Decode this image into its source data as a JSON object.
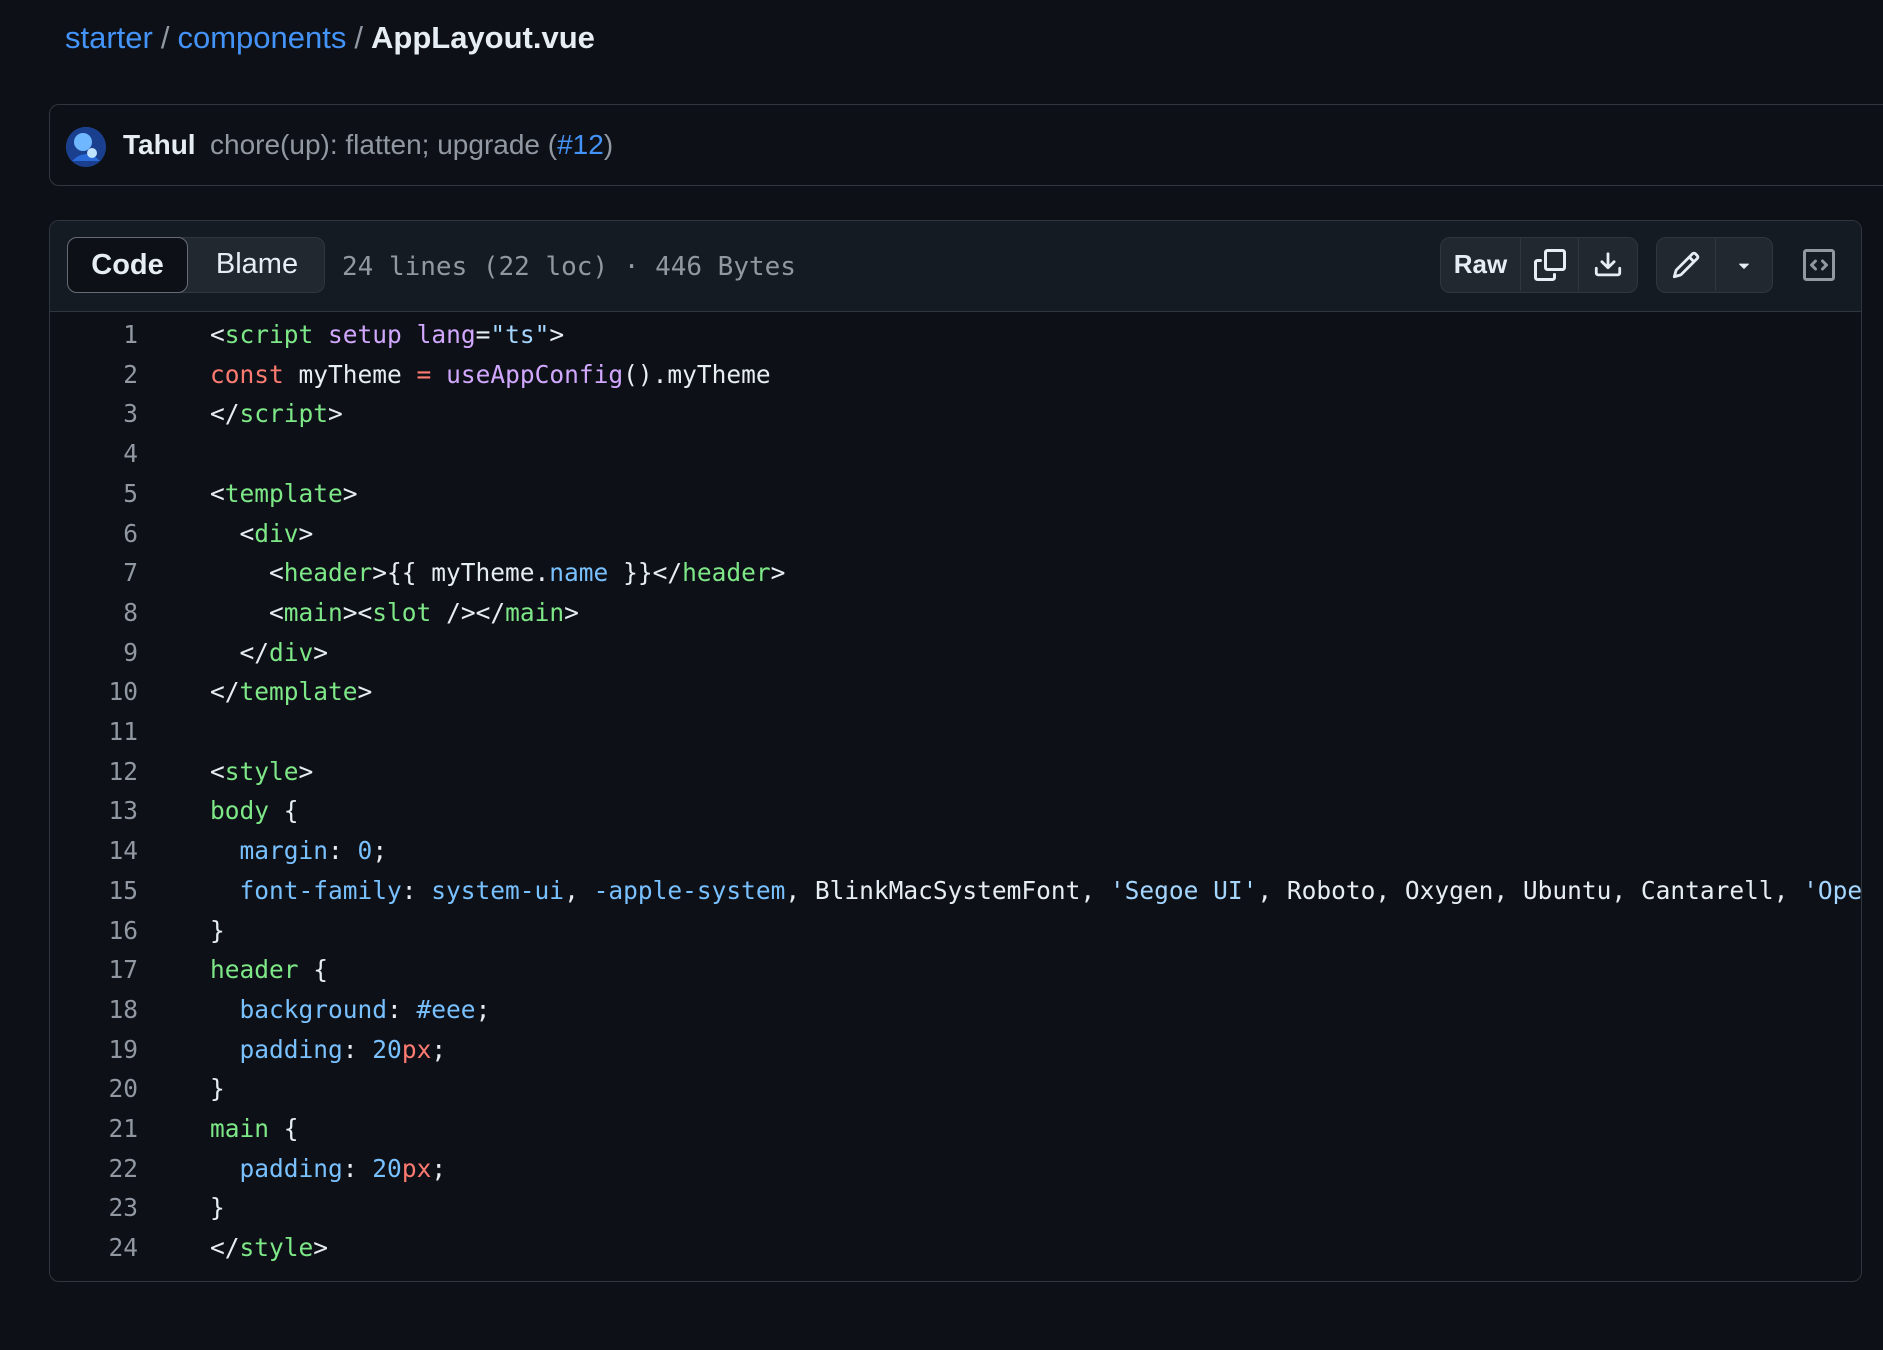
{
  "breadcrumb": {
    "items": [
      "starter",
      "components"
    ],
    "separator": "/",
    "current": "AppLayout.vue"
  },
  "commit": {
    "author": "Tahul",
    "message": "chore(up): flatten; upgrade (",
    "pr": "#12",
    "message_end": ")"
  },
  "file": {
    "tabs": {
      "code": "Code",
      "blame": "Blame"
    },
    "meta": "24 lines (22 loc) · 446 Bytes",
    "actions": {
      "raw": "Raw"
    }
  },
  "code_lines": [
    {
      "num": "1",
      "tokens": [
        [
          "t-plain",
          "<"
        ],
        [
          "t-tag",
          "script"
        ],
        [
          "t-plain",
          " "
        ],
        [
          "t-attr",
          "setup"
        ],
        [
          "t-plain",
          " "
        ],
        [
          "t-attr",
          "lang"
        ],
        [
          "t-plain",
          "="
        ],
        [
          "t-str",
          "\"ts\""
        ],
        [
          "t-plain",
          ">"
        ]
      ]
    },
    {
      "num": "2",
      "tokens": [
        [
          "t-kw",
          "const"
        ],
        [
          "t-plain",
          " myTheme "
        ],
        [
          "t-kw",
          "="
        ],
        [
          "t-plain",
          " "
        ],
        [
          "t-fn",
          "useAppConfig"
        ],
        [
          "t-plain",
          "().myTheme"
        ]
      ]
    },
    {
      "num": "3",
      "tokens": [
        [
          "t-plain",
          "</"
        ],
        [
          "t-tag",
          "script"
        ],
        [
          "t-plain",
          ">"
        ]
      ]
    },
    {
      "num": "4",
      "tokens": []
    },
    {
      "num": "5",
      "tokens": [
        [
          "t-plain",
          "<"
        ],
        [
          "t-tag",
          "template"
        ],
        [
          "t-plain",
          ">"
        ]
      ]
    },
    {
      "num": "6",
      "tokens": [
        [
          "t-plain",
          "  <"
        ],
        [
          "t-tag",
          "div"
        ],
        [
          "t-plain",
          ">"
        ]
      ]
    },
    {
      "num": "7",
      "tokens": [
        [
          "t-plain",
          "    <"
        ],
        [
          "t-tag",
          "header"
        ],
        [
          "t-plain",
          ">{{ myTheme."
        ],
        [
          "t-prop",
          "name"
        ],
        [
          "t-plain",
          " }}</"
        ],
        [
          "t-tag",
          "header"
        ],
        [
          "t-plain",
          ">"
        ]
      ]
    },
    {
      "num": "8",
      "tokens": [
        [
          "t-plain",
          "    <"
        ],
        [
          "t-tag",
          "main"
        ],
        [
          "t-plain",
          "><"
        ],
        [
          "t-tag",
          "slot"
        ],
        [
          "t-plain",
          " /></"
        ],
        [
          "t-tag",
          "main"
        ],
        [
          "t-plain",
          ">"
        ]
      ]
    },
    {
      "num": "9",
      "tokens": [
        [
          "t-plain",
          "  </"
        ],
        [
          "t-tag",
          "div"
        ],
        [
          "t-plain",
          ">"
        ]
      ]
    },
    {
      "num": "10",
      "tokens": [
        [
          "t-plain",
          "</"
        ],
        [
          "t-tag",
          "template"
        ],
        [
          "t-plain",
          ">"
        ]
      ]
    },
    {
      "num": "11",
      "tokens": []
    },
    {
      "num": "12",
      "tokens": [
        [
          "t-plain",
          "<"
        ],
        [
          "t-tag",
          "style"
        ],
        [
          "t-plain",
          ">"
        ]
      ]
    },
    {
      "num": "13",
      "tokens": [
        [
          "t-sel",
          "body"
        ],
        [
          "t-plain",
          " {"
        ]
      ]
    },
    {
      "num": "14",
      "tokens": [
        [
          "t-plain",
          "  "
        ],
        [
          "t-prop",
          "margin"
        ],
        [
          "t-plain",
          ": "
        ],
        [
          "t-num",
          "0"
        ],
        [
          "t-plain",
          ";"
        ]
      ]
    },
    {
      "num": "15",
      "tokens": [
        [
          "t-plain",
          "  "
        ],
        [
          "t-prop",
          "font-family"
        ],
        [
          "t-plain",
          ": "
        ],
        [
          "t-prop",
          "system-ui"
        ],
        [
          "t-plain",
          ", "
        ],
        [
          "t-prop",
          "-apple-system"
        ],
        [
          "t-plain",
          ", BlinkMacSystemFont, "
        ],
        [
          "t-str",
          "'Segoe UI'"
        ],
        [
          "t-plain",
          ", Roboto, Oxygen, Ubuntu, Cantarell, "
        ],
        [
          "t-str",
          "'Open S"
        ]
      ]
    },
    {
      "num": "16",
      "tokens": [
        [
          "t-plain",
          "}"
        ]
      ]
    },
    {
      "num": "17",
      "tokens": [
        [
          "t-sel",
          "header"
        ],
        [
          "t-plain",
          " {"
        ]
      ]
    },
    {
      "num": "18",
      "tokens": [
        [
          "t-plain",
          "  "
        ],
        [
          "t-prop",
          "background"
        ],
        [
          "t-plain",
          ": "
        ],
        [
          "t-num",
          "#eee"
        ],
        [
          "t-plain",
          ";"
        ]
      ]
    },
    {
      "num": "19",
      "tokens": [
        [
          "t-plain",
          "  "
        ],
        [
          "t-prop",
          "padding"
        ],
        [
          "t-plain",
          ": "
        ],
        [
          "t-num",
          "20"
        ],
        [
          "t-unit",
          "px"
        ],
        [
          "t-plain",
          ";"
        ]
      ]
    },
    {
      "num": "20",
      "tokens": [
        [
          "t-plain",
          "}"
        ]
      ]
    },
    {
      "num": "21",
      "tokens": [
        [
          "t-sel",
          "main"
        ],
        [
          "t-plain",
          " {"
        ]
      ]
    },
    {
      "num": "22",
      "tokens": [
        [
          "t-plain",
          "  "
        ],
        [
          "t-prop",
          "padding"
        ],
        [
          "t-plain",
          ": "
        ],
        [
          "t-num",
          "20"
        ],
        [
          "t-unit",
          "px"
        ],
        [
          "t-plain",
          ";"
        ]
      ]
    },
    {
      "num": "23",
      "tokens": [
        [
          "t-plain",
          "}"
        ]
      ]
    },
    {
      "num": "24",
      "tokens": [
        [
          "t-plain",
          "</"
        ],
        [
          "t-tag",
          "style"
        ],
        [
          "t-plain",
          ">"
        ]
      ]
    }
  ],
  "colors": {
    "background": "#0d1117",
    "link": "#4493f8",
    "border": "#30363d",
    "muted": "#9198a1"
  },
  "icons": {
    "copy": "copy-icon",
    "download": "download-icon",
    "edit": "pencil-icon",
    "more": "triangle-down-icon",
    "symbols": "code-square-icon"
  }
}
